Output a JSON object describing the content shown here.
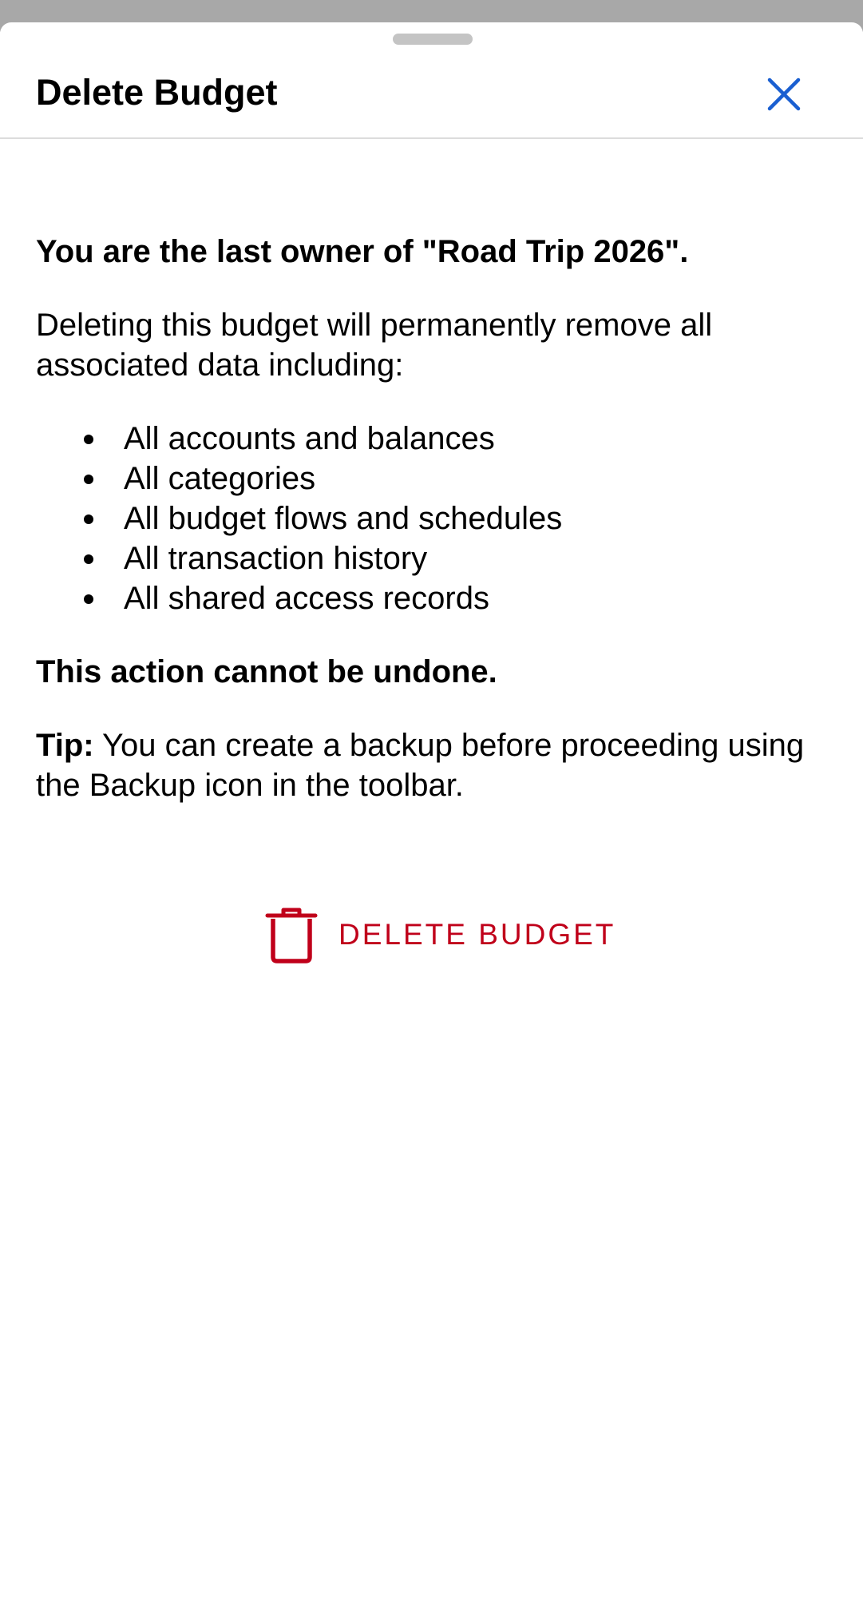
{
  "sheet": {
    "title": "Delete Budget",
    "close_icon": "close-icon"
  },
  "message": {
    "lead": "You are the last owner of \"Road Trip 2026\".",
    "intro": "Deleting this budget will permanently remove all associated data including:",
    "items": [
      "All accounts and balances",
      "All categories",
      "All budget flows and schedules",
      "All transaction history",
      "All shared access records"
    ],
    "warning": "This action cannot be undone.",
    "tip_label": "Tip:",
    "tip_text": " You can create a backup before proceeding using the Backup icon in the toolbar."
  },
  "actions": {
    "delete_label": "DELETE BUDGET",
    "delete_icon": "trash-icon"
  },
  "colors": {
    "accent": "#1a5fd1",
    "destructive": "#c0001a",
    "divider": "#dcdcdc",
    "backdrop": "#a8a8a8"
  }
}
